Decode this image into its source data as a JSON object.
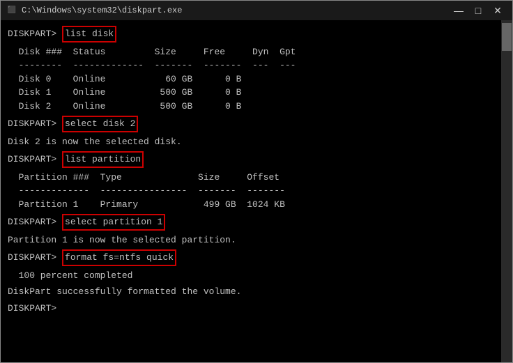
{
  "window": {
    "title": "C:\\Windows\\system32\\diskpart.exe"
  },
  "titlebar": {
    "minimize": "—",
    "maximize": "□",
    "close": "✕"
  },
  "terminal": {
    "lines": [
      {
        "type": "prompt-cmd",
        "prompt": "DISKPART> ",
        "cmd": "list disk"
      },
      {
        "type": "blank"
      },
      {
        "type": "text",
        "content": "  Disk ###  Status         Size     Free     Dyn  Gpt"
      },
      {
        "type": "text",
        "content": "  --------  -------------  -------  -------  ---  ---"
      },
      {
        "type": "text",
        "content": "  Disk 0    Online           60 GB      0 B"
      },
      {
        "type": "text",
        "content": "  Disk 1    Online          500 GB      0 B"
      },
      {
        "type": "text",
        "content": "  Disk 2    Online          500 GB      0 B"
      },
      {
        "type": "blank"
      },
      {
        "type": "prompt-cmd",
        "prompt": "DISKPART> ",
        "cmd": "select disk 2"
      },
      {
        "type": "blank"
      },
      {
        "type": "text",
        "content": "Disk 2 is now the selected disk."
      },
      {
        "type": "blank"
      },
      {
        "type": "prompt-cmd",
        "prompt": "DISKPART> ",
        "cmd": "list partition"
      },
      {
        "type": "blank"
      },
      {
        "type": "text",
        "content": "  Partition ###  Type              Size     Offset"
      },
      {
        "type": "text",
        "content": "  -------------  ----------------  -------  -------"
      },
      {
        "type": "text",
        "content": "  Partition 1    Primary            499 GB  1024 KB"
      },
      {
        "type": "blank"
      },
      {
        "type": "prompt-cmd",
        "prompt": "DISKPART> ",
        "cmd": "select partition 1"
      },
      {
        "type": "blank"
      },
      {
        "type": "text",
        "content": "Partition 1 is now the selected partition."
      },
      {
        "type": "blank"
      },
      {
        "type": "prompt-cmd",
        "prompt": "DISKPART> ",
        "cmd": "format fs=ntfs quick"
      },
      {
        "type": "blank"
      },
      {
        "type": "text",
        "content": "  100 percent completed"
      },
      {
        "type": "blank"
      },
      {
        "type": "text",
        "content": "DiskPart successfully formatted the volume."
      },
      {
        "type": "blank"
      },
      {
        "type": "prompt-only",
        "prompt": "DISKPART> "
      }
    ]
  }
}
